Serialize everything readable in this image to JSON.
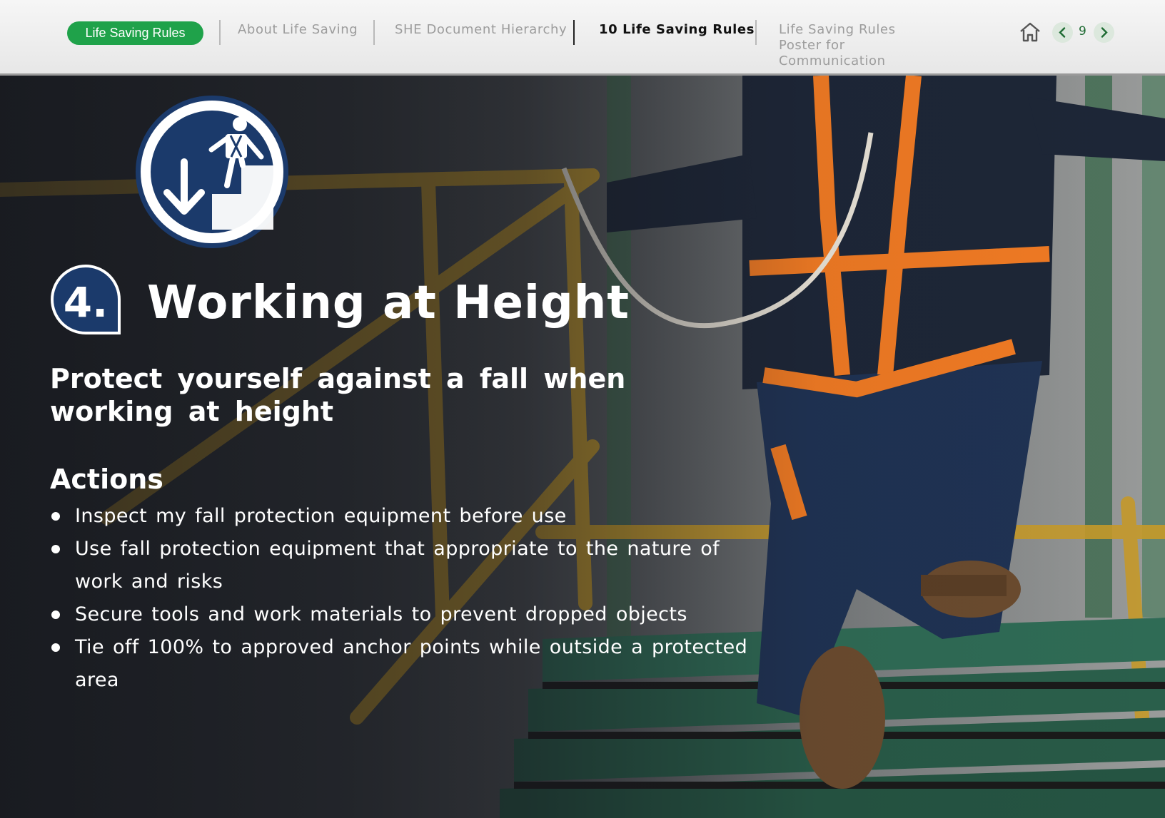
{
  "nav": {
    "brand_pill": "Life Saving Rules",
    "links": [
      {
        "label": "About Life Saving",
        "active": false
      },
      {
        "label": "SHE Document Hierarchy",
        "active": false
      },
      {
        "label": "10 Life Saving Rules",
        "active": true
      },
      {
        "label": "Life Saving Rules Poster for Communication",
        "active": false
      }
    ],
    "page_number": "9",
    "icons": [
      "home-icon",
      "chevron-left-icon",
      "chevron-right-icon"
    ],
    "accent_color": "#1fa24a"
  },
  "rule": {
    "number": "4.",
    "title": "Working at Height",
    "subtitle": "Protect yourself against a fall when working at height",
    "actions_heading": "Actions",
    "actions": [
      "Inspect my fall protection equipment before use",
      "Use fall protection equipment that appropriate to the nature of work and risks",
      "Secure tools and work materials to prevent dropped objects",
      "Tie off 100% to approved anchor points while outside a protected area"
    ],
    "sign_icon": "fall-protection-sign-icon",
    "sign_color": "#1b3a6b"
  }
}
